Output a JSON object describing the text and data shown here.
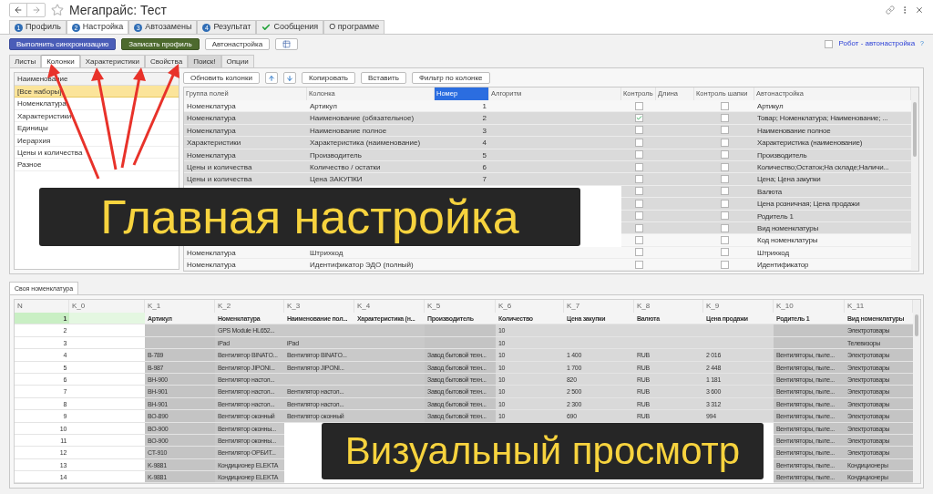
{
  "window": {
    "title": "Мегапрайс: Тест"
  },
  "tabs": [
    {
      "label": "Профиль",
      "kind": "numbered",
      "badge": "1",
      "selected": false
    },
    {
      "label": "Настройка",
      "kind": "numbered",
      "badge": "2",
      "selected": true
    },
    {
      "label": "Автозамены",
      "kind": "numbered",
      "badge": "3",
      "selected": false
    },
    {
      "label": "Результат",
      "kind": "numbered",
      "badge": "4",
      "selected": false
    },
    {
      "label": "Сообщения",
      "kind": "checked",
      "selected": false
    },
    {
      "label": "О программе",
      "kind": "plain",
      "selected": false
    }
  ],
  "toolbar": {
    "buttons": [
      {
        "label": "Выполнить синхронизацию",
        "kind": "primary"
      },
      {
        "label": "Записать профиль",
        "kind": "save"
      },
      {
        "label": "Автонастройка",
        "kind": "plain"
      },
      {
        "kind": "icon"
      }
    ],
    "robot": {
      "label": "Робот - автонастройка",
      "checked": false,
      "help": "?"
    }
  },
  "subtabs": [
    {
      "label": "Листы",
      "selected": false,
      "highlighted": false
    },
    {
      "label": "Колонки",
      "selected": true,
      "highlighted": false
    },
    {
      "label": "Характеристики",
      "selected": false,
      "highlighted": false
    },
    {
      "label": "Свойства",
      "selected": false,
      "highlighted": false
    },
    {
      "label": "Поиск!",
      "selected": false,
      "highlighted": true
    },
    {
      "label": "Опции",
      "selected": false,
      "highlighted": false
    }
  ],
  "sets": {
    "header": "Наименование",
    "items": [
      {
        "label": "[Все наборы]",
        "selected": true
      },
      {
        "label": "Номенклатура",
        "selected": false
      },
      {
        "label": "Характеристики",
        "selected": false
      },
      {
        "label": "Единицы",
        "selected": false
      },
      {
        "label": "Иерархия",
        "selected": false
      },
      {
        "label": "Цены и количества",
        "selected": false
      },
      {
        "label": "Разное",
        "selected": false
      }
    ]
  },
  "columns_toolbar": [
    {
      "label": "Обновить колонки",
      "kind": "text"
    },
    {
      "kind": "up"
    },
    {
      "kind": "down"
    },
    {
      "label": "Копировать",
      "kind": "text"
    },
    {
      "label": "Вставить",
      "kind": "text"
    },
    {
      "label": "Фильтр по колонке",
      "kind": "text"
    }
  ],
  "columns_table": {
    "columns": [
      {
        "label": "Группа полей",
        "selected": false
      },
      {
        "label": "Колонка",
        "selected": false
      },
      {
        "label": "Номер",
        "selected": true
      },
      {
        "label": "Алгоритм",
        "selected": false
      },
      {
        "label": "Контроль",
        "selected": false
      },
      {
        "label": "Длина",
        "selected": false
      },
      {
        "label": "Контроль шапки",
        "selected": false
      },
      {
        "label": "Автонастройка",
        "selected": false
      }
    ],
    "rows": [
      {
        "group": "Номенклатура",
        "column": "Артикул",
        "number": "1",
        "control": false,
        "header_control": false,
        "auto": "Артикул",
        "highlighted": false
      },
      {
        "group": "Номенклатура",
        "column": "Наименование (обязательное)",
        "number": "2",
        "control": true,
        "header_control": false,
        "auto": "Товар; Номенклатура; Наименование; ...",
        "highlighted": true
      },
      {
        "group": "Номенклатура",
        "column": "Наименование полное",
        "number": "3",
        "control": false,
        "header_control": false,
        "auto": "Наименование полное",
        "highlighted": true
      },
      {
        "group": "Характеристики",
        "column": "Характеристика (наименование)",
        "number": "4",
        "control": false,
        "header_control": false,
        "auto": "Характеристика (наименование)",
        "highlighted": true
      },
      {
        "group": "Номенклатура",
        "column": "Производитель",
        "number": "5",
        "control": false,
        "header_control": false,
        "auto": "Производитель",
        "highlighted": true
      },
      {
        "group": "Цены и количества",
        "column": "Количество / остатки",
        "number": "6",
        "control": false,
        "header_control": false,
        "auto": "Количество;Остаток;На складе;Наличи...",
        "highlighted": true
      },
      {
        "group": "Цены и количества",
        "column": "Цена ЗАКУПКИ",
        "number": "7",
        "control": false,
        "header_control": false,
        "auto": "Цена; Цена закупки",
        "highlighted": true
      },
      {
        "control": false,
        "header_control": false,
        "auto": "Валюта",
        "highlighted": true
      },
      {
        "control": false,
        "header_control": false,
        "auto": "Цена розничная; Цена продажи",
        "highlighted": true
      },
      {
        "control": false,
        "header_control": false,
        "auto": "Родитель 1",
        "highlighted": true
      },
      {
        "control": false,
        "header_control": false,
        "auto": "Вид номенклатуры",
        "highlighted": true
      },
      {
        "control": false,
        "header_control": false,
        "auto": "Код номенклатуры",
        "highlighted": false
      },
      {
        "group": "Номенклатура",
        "column": "Штрихкод",
        "control": false,
        "header_control": false,
        "auto": "Штрихкод",
        "highlighted": false
      },
      {
        "group": "Номенклатура",
        "column": "Идентификатор ЭДО (полный)",
        "control": false,
        "header_control": false,
        "auto": "Идентификатор",
        "highlighted": false
      }
    ]
  },
  "preview": {
    "tab": "Своя номенклатура",
    "columns": [
      "N",
      "K_0",
      "K_1",
      "K_2",
      "K_3",
      "K_4",
      "K_5",
      "K_6",
      "K_7",
      "K_8",
      "K_9",
      "K_10",
      "K_11"
    ],
    "rows": [
      {
        "selected": true,
        "cells": [
          "1",
          "",
          "Артикул",
          "Номенклатура",
          "Наименование пол...",
          "Характеристика (н...",
          "Производитель",
          "Количество",
          "Цена закупки",
          "Валюта",
          "Цена продажи",
          "Родитель 1",
          "Вид номенклатуры"
        ]
      },
      {
        "selected": false,
        "cells": [
          "2",
          "",
          "",
          "GPS Module HL652...",
          "",
          "",
          "",
          "10",
          "",
          "",
          "",
          "",
          "Электротовары"
        ]
      },
      {
        "selected": false,
        "cells": [
          "3",
          "",
          "",
          "iPad",
          "iPad",
          "",
          "",
          "10",
          "",
          "",
          "",
          "",
          "Телевизоры"
        ]
      },
      {
        "selected": false,
        "cells": [
          "4",
          "",
          "B-789",
          "Вентилятор BINATO...",
          "Вентилятор BINATO...",
          "",
          "Завод бытовой техн...",
          "10",
          "1 400",
          "RUB",
          "2 016",
          "Вентиляторы, пыле...",
          "Электротовары"
        ]
      },
      {
        "selected": false,
        "cells": [
          "5",
          "",
          "B-987",
          "Вентилятор JIPONI...",
          "Вентилятор JIPONI...",
          "",
          "Завод бытовой техн...",
          "10",
          "1 700",
          "RUB",
          "2 448",
          "Вентиляторы, пыле...",
          "Электротовары"
        ]
      },
      {
        "selected": false,
        "cells": [
          "6",
          "",
          "BH-900",
          "Вентилятор настол...",
          "",
          "",
          "Завод бытовой техн...",
          "10",
          "820",
          "RUB",
          "1 181",
          "Вентиляторы, пыле...",
          "Электротовары"
        ]
      },
      {
        "selected": false,
        "cells": [
          "7",
          "",
          "BH-901",
          "Вентилятор настол...",
          "Вентилятор настол...",
          "",
          "Завод бытовой техн...",
          "10",
          "2 500",
          "RUB",
          "3 600",
          "Вентиляторы, пыле...",
          "Электротовары"
        ]
      },
      {
        "selected": false,
        "cells": [
          "8",
          "",
          "BH-901",
          "Вентилятор настол...",
          "Вентилятор настол...",
          "",
          "Завод бытовой техн...",
          "10",
          "2 300",
          "RUB",
          "3 312",
          "Вентиляторы, пыле...",
          "Электротовары"
        ]
      },
      {
        "selected": false,
        "cells": [
          "9",
          "",
          "BO-890",
          "Вентилятор оконный",
          "Вентилятор оконный",
          "",
          "Завод бытовой техн...",
          "10",
          "690",
          "RUB",
          "994",
          "Вентиляторы, пыле...",
          "Электротовары"
        ]
      },
      {
        "selected": false,
        "cells": [
          "10",
          "",
          "BO-900",
          "Вентилятор оконны...",
          null,
          null,
          null,
          null,
          null,
          null,
          null,
          "Вентиляторы, пыле...",
          "Электротовары"
        ]
      },
      {
        "selected": false,
        "cells": [
          "11",
          "",
          "BO-900",
          "Вентилятор оконны...",
          null,
          null,
          null,
          null,
          null,
          null,
          null,
          "Вентиляторы, пыле...",
          "Электротовары"
        ]
      },
      {
        "selected": false,
        "cells": [
          "12",
          "",
          "CT-910",
          "Вентилятор ОРБИТ...",
          null,
          null,
          null,
          null,
          null,
          null,
          null,
          "Вентиляторы, пыле...",
          "Электротовары"
        ]
      },
      {
        "selected": false,
        "cells": [
          "13",
          "",
          "K-9881",
          "Кондиционер ELEKTA",
          null,
          null,
          null,
          null,
          null,
          null,
          null,
          "Вентиляторы, пыле...",
          "Кондиционеры"
        ]
      },
      {
        "selected": false,
        "cells": [
          "14",
          "",
          "K-9881",
          "Кондиционер ELEKTA",
          null,
          null,
          null,
          null,
          null,
          null,
          null,
          "Вентиляторы, пыле...",
          "Кондиционеры"
        ]
      }
    ]
  },
  "captions": [
    {
      "text": "Главная настройка",
      "kind": "main"
    },
    {
      "text": "Визуальный просмотр",
      "kind": "preview"
    }
  ]
}
